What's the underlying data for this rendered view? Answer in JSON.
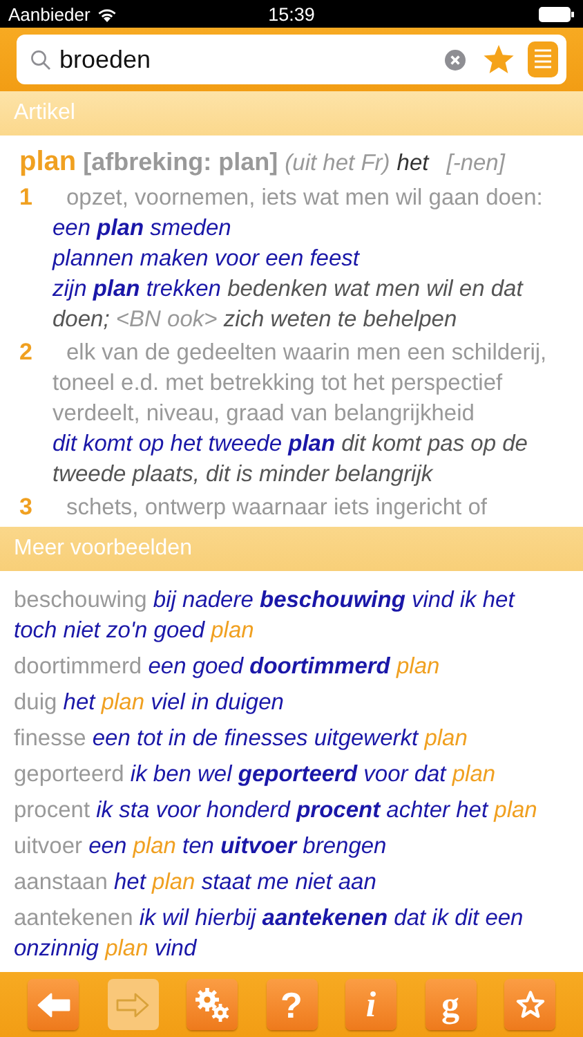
{
  "status_bar": {
    "carrier": "Aanbieder",
    "time": "15:39"
  },
  "search": {
    "value": "broeden"
  },
  "article": {
    "header": "Artikel",
    "headword": [
      {
        "kind": "headword",
        "text": "plan"
      },
      {
        "kind": "hyphenation",
        "text": "[afbreking: plan]"
      },
      {
        "kind": "origin",
        "text": "(uit het Fr)"
      },
      {
        "kind": "article",
        "text": "het"
      },
      {
        "kind": "plural",
        "text": "[-nen]"
      }
    ],
    "senses": [
      {
        "number": "1",
        "definition": "opzet, voornemen, iets wat men wil gaan doen:",
        "examples": [
          [
            {
              "kind": "phrase",
              "text": "een **plan** smeden"
            }
          ],
          [
            {
              "kind": "phrase",
              "text": "plannen maken voor een feest"
            }
          ],
          [
            {
              "kind": "phrase",
              "text": "zijn **plan** trekken"
            },
            {
              "kind": "meaning",
              "text": "bedenken wat men wil en dat doen;"
            },
            {
              "kind": "label",
              "text": "<BN ook>"
            },
            {
              "kind": "meaning",
              "text": "zich weten te behelpen"
            }
          ]
        ]
      },
      {
        "number": "2",
        "definition": "elk van de gedeelten waarin men een schilderij, toneel e.d. met betrekking tot het perspectief verdeelt, niveau, graad van belangrijkheid",
        "examples": [
          [
            {
              "kind": "phrase",
              "text": "dit komt op het tweede **plan**"
            },
            {
              "kind": "meaning",
              "text": "dit komt pas op de tweede plaats, dit is minder belangrijk"
            }
          ]
        ]
      },
      {
        "number": "3",
        "definition": "schets, ontwerp waarnaar iets ingericht of"
      }
    ]
  },
  "more": {
    "header": "Meer voorbeelden",
    "rows": [
      {
        "entry": "beschouwing",
        "example": [
          {
            "kind": "phrase",
            "text": "bij nadere **beschouwing** vind ik het toch niet zo'n goed"
          },
          {
            "kind": "headword",
            "text": "plan"
          }
        ]
      },
      {
        "entry": "doortimmerd",
        "example": [
          {
            "kind": "phrase",
            "text": "een goed **doortimmerd**"
          },
          {
            "kind": "headword",
            "text": "plan"
          }
        ]
      },
      {
        "entry": "duig",
        "example": [
          {
            "kind": "phrase",
            "text": "het"
          },
          {
            "kind": "headword",
            "text": "plan"
          },
          {
            "kind": "phrase",
            "text": "viel in duigen"
          }
        ]
      },
      {
        "entry": "finesse",
        "example": [
          {
            "kind": "phrase",
            "text": "een tot in de finesses uitgewerkt"
          },
          {
            "kind": "headword",
            "text": "plan"
          }
        ]
      },
      {
        "entry": "geporteerd",
        "example": [
          {
            "kind": "phrase",
            "text": "ik ben wel **geporteerd** voor dat"
          },
          {
            "kind": "headword",
            "text": "plan"
          }
        ]
      },
      {
        "entry": "procent",
        "example": [
          {
            "kind": "phrase",
            "text": "ik sta voor honderd **procent** achter het"
          },
          {
            "kind": "headword",
            "text": "plan"
          }
        ]
      },
      {
        "entry": "uitvoer",
        "example": [
          {
            "kind": "phrase",
            "text": "een"
          },
          {
            "kind": "headword",
            "text": "plan"
          },
          {
            "kind": "phrase",
            "text": "ten **uitvoer** brengen"
          }
        ]
      },
      {
        "entry": "aanstaan",
        "example": [
          {
            "kind": "phrase",
            "text": "het"
          },
          {
            "kind": "headword",
            "text": "plan"
          },
          {
            "kind": "phrase",
            "text": "staat me niet aan"
          }
        ]
      },
      {
        "entry": "aantekenen",
        "example": [
          {
            "kind": "phrase",
            "text": "ik wil hierbij **aantekenen** dat ik dit een onzinnig"
          },
          {
            "kind": "headword",
            "text": "plan"
          },
          {
            "kind": "phrase",
            "text": "vind"
          }
        ]
      }
    ]
  },
  "toolbar": [
    {
      "kind": "back",
      "disabled": false
    },
    {
      "kind": "forward",
      "disabled": true
    },
    {
      "kind": "settings",
      "disabled": false
    },
    {
      "kind": "glyph",
      "label": "?",
      "disabled": false
    },
    {
      "kind": "glyph",
      "label": "i",
      "disabled": false
    },
    {
      "kind": "glyph",
      "label": "g",
      "disabled": false
    },
    {
      "kind": "favorite",
      "disabled": false
    }
  ]
}
